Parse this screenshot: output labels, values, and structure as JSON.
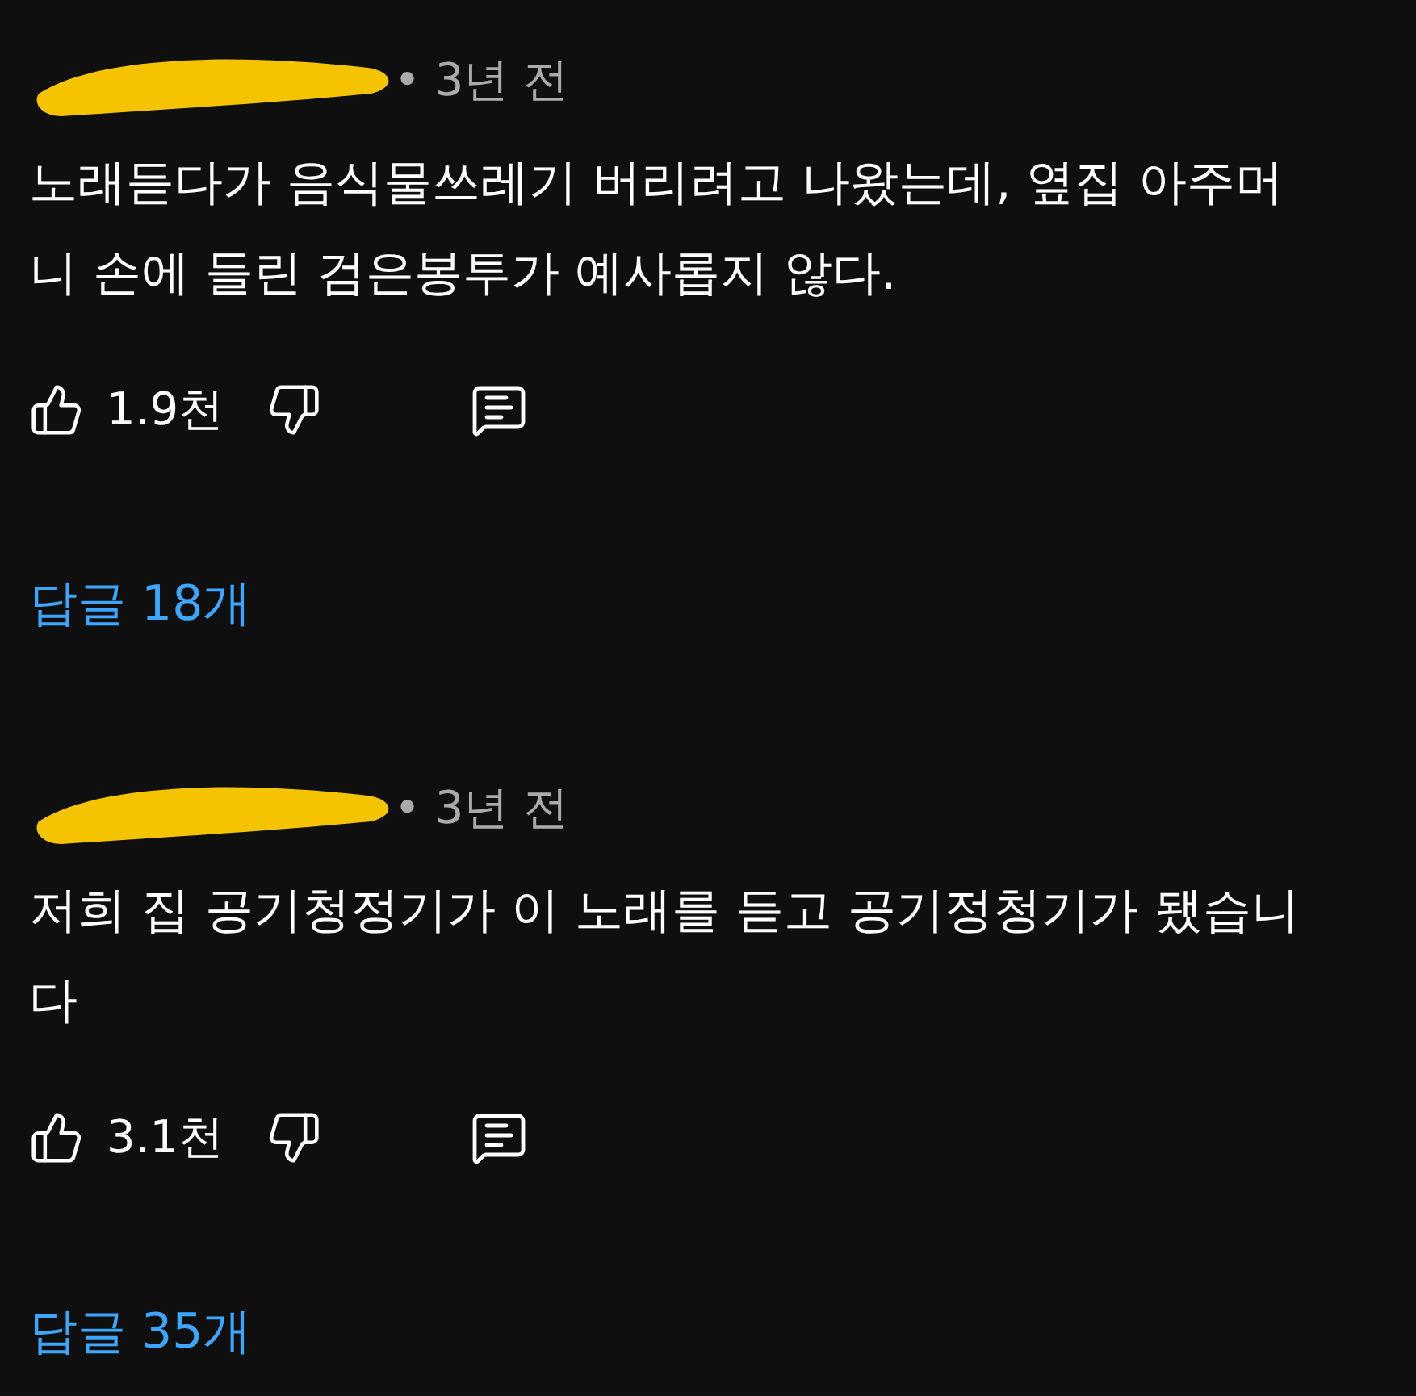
{
  "comments": [
    {
      "time": "• 3년 전",
      "text": "노래듣다가 음식물쓰레기 버리려고 나왔는데, 옆집 아주머니 손에 들린 검은봉투가 예사롭지 않다.",
      "likes": "1.9천",
      "replies": "답글 18개"
    },
    {
      "time": "• 3년 전",
      "text": "저희 집 공기청정기가 이 노래를 듣고 공기정청기가 됐습니다",
      "likes": "3.1천",
      "replies": "답글 35개"
    }
  ]
}
